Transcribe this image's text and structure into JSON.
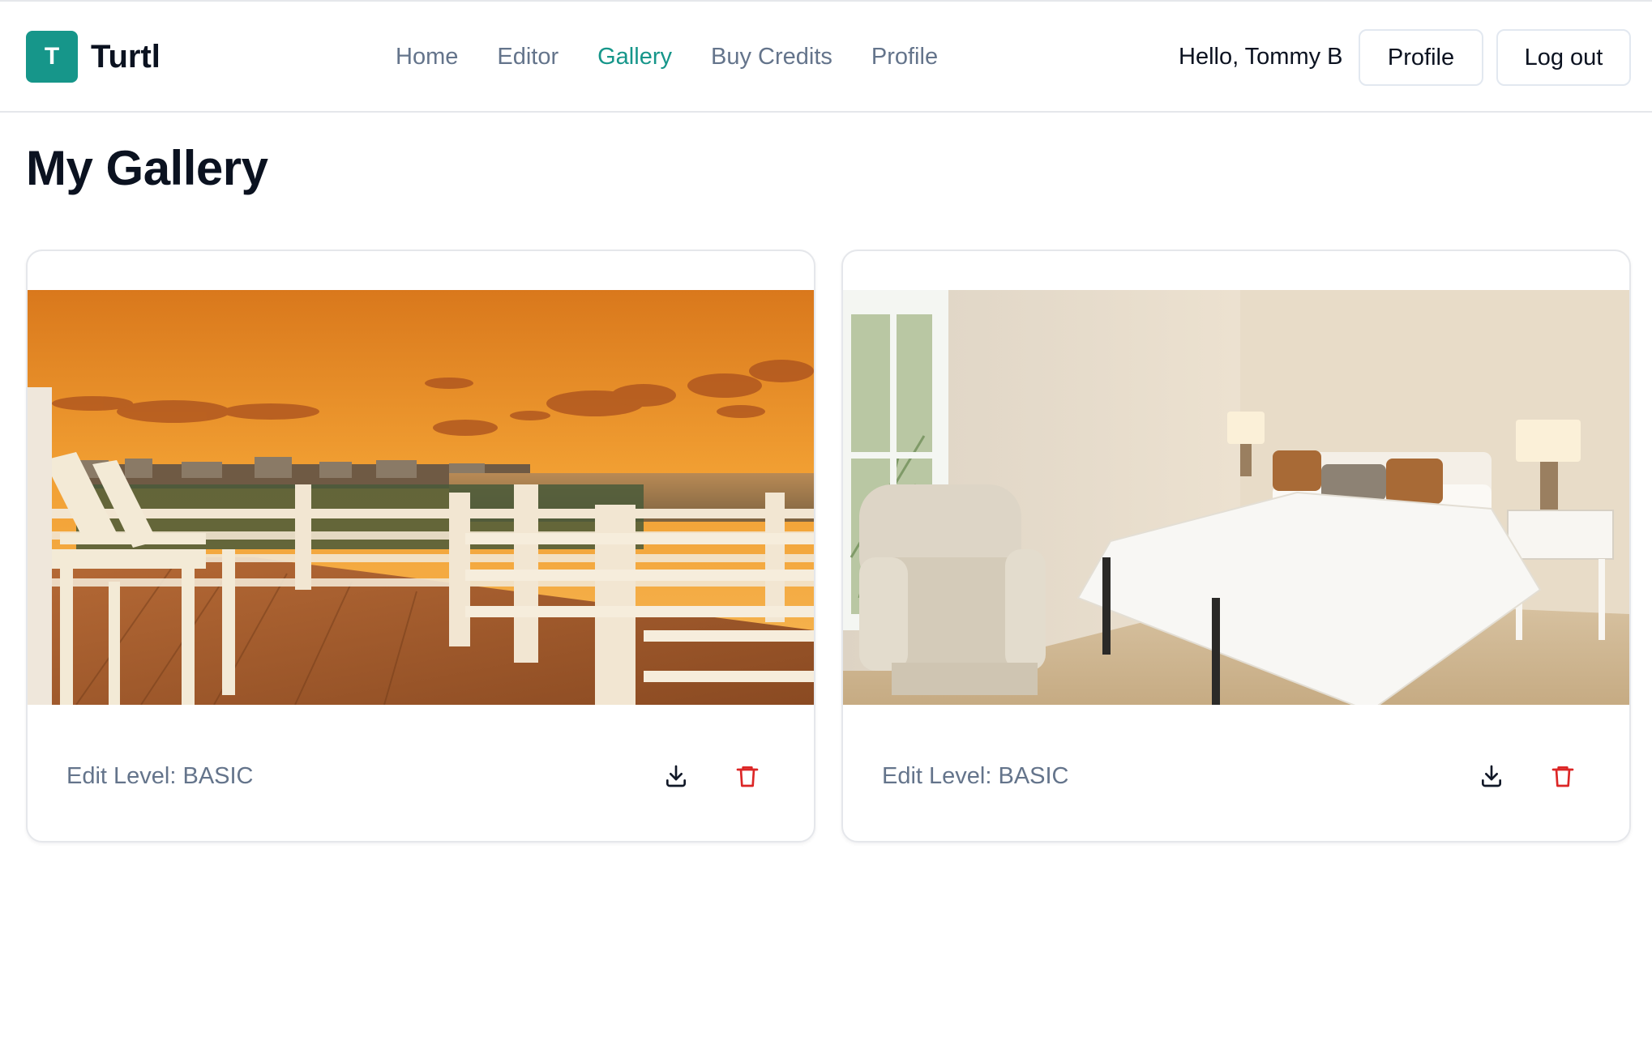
{
  "app": {
    "logo_letter": "T",
    "brand_name": "Turtl"
  },
  "nav": {
    "items": [
      {
        "label": "Home",
        "active": false
      },
      {
        "label": "Editor",
        "active": false
      },
      {
        "label": "Gallery",
        "active": true
      },
      {
        "label": "Buy Credits",
        "active": false
      },
      {
        "label": "Profile",
        "active": false
      }
    ]
  },
  "user": {
    "greeting": "Hello, Tommy B",
    "profile_button": "Profile",
    "logout_button": "Log out"
  },
  "page": {
    "title": "My Gallery"
  },
  "gallery": {
    "items": [
      {
        "edit_level": "Edit Level: BASIC",
        "image_subject": "rooftop deck at sunset"
      },
      {
        "edit_level": "Edit Level: BASIC",
        "image_subject": "bedroom with armchair and bed"
      }
    ]
  },
  "colors": {
    "accent": "#16968a",
    "nav_inactive": "#64748b",
    "delete": "#dc2626",
    "border": "#e5e7eb"
  },
  "icons": {
    "download": "download-icon",
    "delete": "trash-icon"
  }
}
